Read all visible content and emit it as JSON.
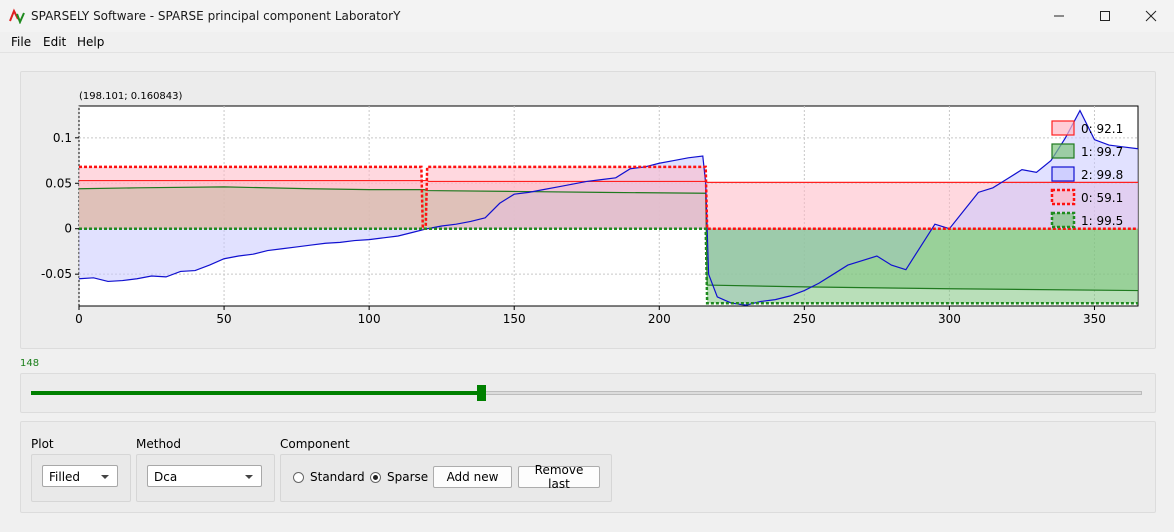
{
  "window": {
    "title": "SPARSELY Software - SPARSE principal component LaboratorY",
    "minimize_icon": "minimize-icon",
    "maximize_icon": "maximize-icon",
    "close_icon": "close-icon"
  },
  "menu": {
    "file": "File",
    "edit": "Edit",
    "help": "Help"
  },
  "plot": {
    "coord_readout": "(198.101; 0.160843)"
  },
  "chart_data": {
    "type": "area",
    "xlim": [
      0,
      365
    ],
    "ylim": [
      -0.085,
      0.135
    ],
    "grid": true,
    "x_ticks": [
      0,
      50,
      100,
      150,
      200,
      250,
      300,
      350
    ],
    "y_ticks": [
      0.1,
      0.05,
      0,
      -0.05
    ],
    "x_tick_labels": [
      "0",
      "50",
      "100",
      "150",
      "200",
      "250",
      "300",
      "350"
    ],
    "y_tick_labels": [
      "0.1",
      "0.05",
      "0",
      "-0.05"
    ],
    "legend_position": "top-right",
    "series": [
      {
        "name": "0: 92.1",
        "style": "filled",
        "color": "#ff2020",
        "fill": "#ffb8c4",
        "x": [
          0,
          120,
          120.5,
          216,
          216.5,
          365
        ],
        "values": [
          0.053,
          0.053,
          0.052,
          0.052,
          0.051,
          0.051
        ]
      },
      {
        "name": "1: 99.7",
        "style": "filled",
        "color": "#1f7a1f",
        "fill": "#7fc47f",
        "x": [
          0,
          20,
          50,
          80,
          100,
          119,
          120,
          150,
          180,
          216,
          216.5,
          250,
          300,
          365
        ],
        "values": [
          0.044,
          0.045,
          0.046,
          0.044,
          0.043,
          0.043,
          0.042,
          0.041,
          0.04,
          0.039,
          -0.062,
          -0.064,
          -0.066,
          -0.068
        ]
      },
      {
        "name": "2: 99.8",
        "style": "filled",
        "color": "#1010d0",
        "fill": "#c8c8ff",
        "x": [
          0,
          5,
          10,
          15,
          20,
          25,
          30,
          35,
          40,
          45,
          50,
          55,
          60,
          65,
          70,
          75,
          80,
          85,
          90,
          95,
          100,
          105,
          110,
          115,
          120,
          125,
          130,
          135,
          140,
          145,
          150,
          155,
          160,
          165,
          170,
          175,
          180,
          185,
          190,
          195,
          200,
          205,
          210,
          215,
          216,
          217,
          220,
          225,
          230,
          235,
          240,
          245,
          250,
          255,
          260,
          265,
          270,
          275,
          280,
          285,
          290,
          295,
          300,
          305,
          310,
          315,
          320,
          325,
          330,
          335,
          340,
          345,
          350,
          355,
          360,
          365
        ],
        "values": [
          -0.055,
          -0.054,
          -0.058,
          -0.057,
          -0.055,
          -0.052,
          -0.053,
          -0.047,
          -0.046,
          -0.04,
          -0.033,
          -0.03,
          -0.028,
          -0.024,
          -0.022,
          -0.02,
          -0.018,
          -0.016,
          -0.015,
          -0.013,
          -0.012,
          -0.01,
          -0.008,
          -0.004,
          0.0,
          0.003,
          0.005,
          0.008,
          0.012,
          0.028,
          0.038,
          0.04,
          0.043,
          0.046,
          0.049,
          0.052,
          0.054,
          0.056,
          0.066,
          0.068,
          0.072,
          0.075,
          0.078,
          0.08,
          0.05,
          -0.05,
          -0.075,
          -0.082,
          -0.084,
          -0.08,
          -0.078,
          -0.074,
          -0.068,
          -0.06,
          -0.05,
          -0.04,
          -0.035,
          -0.03,
          -0.04,
          -0.045,
          -0.02,
          0.005,
          0.0,
          0.02,
          0.04,
          0.045,
          0.055,
          0.065,
          0.062,
          0.075,
          0.1,
          0.13,
          0.098,
          0.092,
          0.09,
          0.088
        ]
      },
      {
        "name": "0: 59.1",
        "style": "dashed-filled",
        "color": "#ff1010",
        "fill": "#ffb8c4",
        "x": [
          0,
          118,
          118.5,
          119.5,
          120,
          216,
          216.5,
          365
        ],
        "values": [
          0.068,
          0.068,
          0.0,
          0.0,
          0.068,
          0.068,
          0.0,
          0.0
        ]
      },
      {
        "name": "1: 99.5",
        "style": "dashed-filled",
        "color": "#1f8a1f",
        "fill": "#7fc47f",
        "x": [
          0,
          216,
          216.5,
          365
        ],
        "values": [
          0.0,
          0.0,
          -0.082,
          -0.082
        ]
      }
    ]
  },
  "slider": {
    "value_label": "148",
    "fraction": 0.405,
    "color": "#008000"
  },
  "controls": {
    "plot_label": "Plot",
    "plot_selected": "Filled",
    "method_label": "Method",
    "method_selected": "Dca",
    "component_label": "Component",
    "standard_label": "Standard",
    "sparse_label": "Sparse",
    "standard_checked": false,
    "sparse_checked": true,
    "add_new_label": "Add new",
    "remove_last_label": "Remove last"
  }
}
